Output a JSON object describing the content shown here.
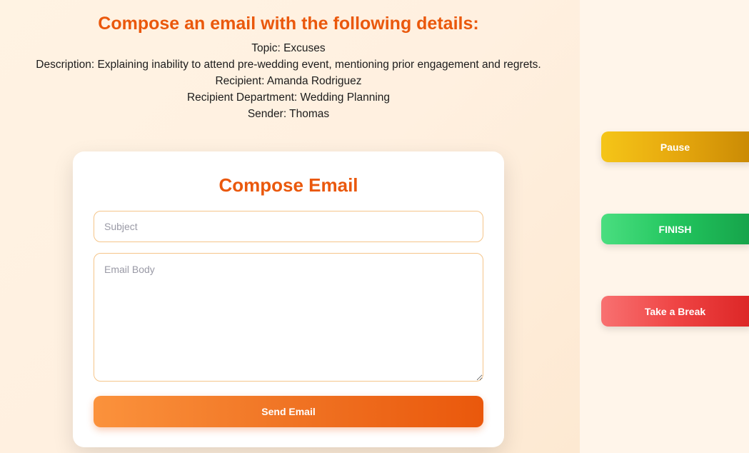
{
  "task": {
    "heading": "Compose an email with the following details:",
    "topic": "Topic: Excuses",
    "description": "Description: Explaining inability to attend pre-wedding event, mentioning prior engagement and regrets.",
    "recipient": "Recipient: Amanda Rodriguez",
    "department": "Recipient Department: Wedding Planning",
    "sender": "Sender: Thomas"
  },
  "compose": {
    "title": "Compose Email",
    "subject_value": "",
    "subject_placeholder": "Subject",
    "body_value": "",
    "body_placeholder": "Email Body",
    "send_label": "Send Email"
  },
  "controls": {
    "pause_label": "Pause",
    "finish_label": "FINISH",
    "break_label": "Take a Break"
  },
  "colors": {
    "accent": "#ea580c",
    "pause": "#eab308",
    "finish": "#22c55e",
    "break": "#ef4444"
  }
}
